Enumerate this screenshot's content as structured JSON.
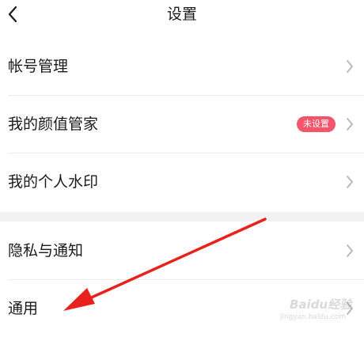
{
  "header": {
    "title": "设置",
    "back_icon": "chevron-left-icon"
  },
  "groups": [
    {
      "items": [
        {
          "label": "帐号管理",
          "icon": "chevron-right-icon"
        },
        {
          "label": "我的颜值管家",
          "badge": "未设置",
          "icon": "chevron-right-icon"
        },
        {
          "label": "我的个人水印",
          "icon": "chevron-right-icon"
        }
      ]
    },
    {
      "items": [
        {
          "label": "隐私与通知",
          "icon": "chevron-right-icon"
        },
        {
          "label": "通用",
          "icon": "chevron-right-icon"
        }
      ]
    }
  ],
  "watermark": {
    "brand": "Baidu经验",
    "url": "jingyan.baidu.com"
  },
  "colors": {
    "badge_bg": "#f4556b",
    "chevron": "#b5b5b5",
    "divider": "#ececec",
    "section_gap": "#f2f2f2",
    "annotation_arrow": "#e8221b"
  }
}
